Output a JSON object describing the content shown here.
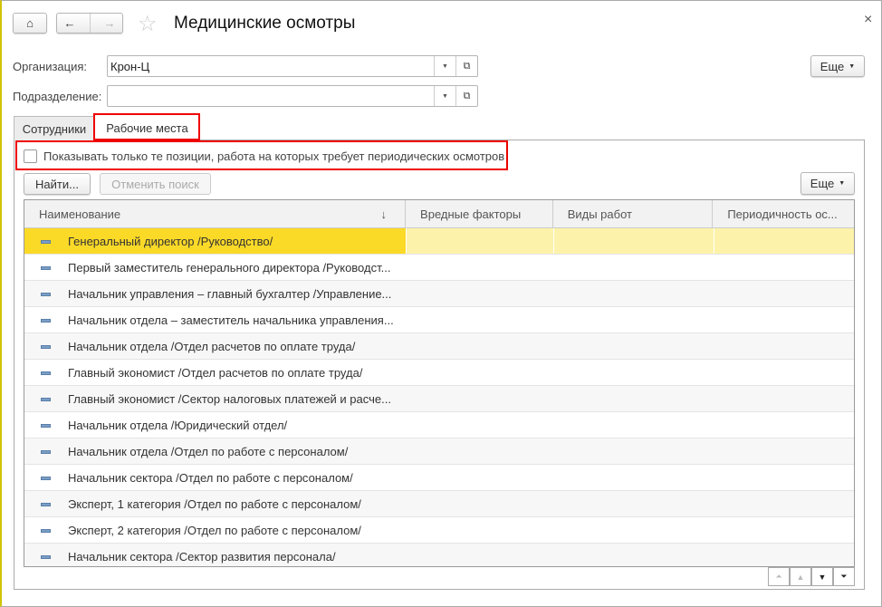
{
  "header": {
    "title": "Медицинские осмотры",
    "close": "×",
    "home_icon": "home-icon",
    "back_icon": "arrow-left-icon",
    "forward_icon": "arrow-right-icon",
    "favorite_icon": "star-icon"
  },
  "form": {
    "org_label": "Организация:",
    "org_value": "Крон-Ц",
    "dept_label": "Подразделение:",
    "dept_value": "",
    "more": "Еще"
  },
  "tabs": [
    {
      "label": "Сотрудники",
      "active": false
    },
    {
      "label": "Рабочие места",
      "active": true
    }
  ],
  "filter": {
    "checkbox_label": "Показывать только те позиции, работа на которых требует периодических осмотров",
    "checked": false
  },
  "toolbar": {
    "find": "Найти...",
    "cancel_search": "Отменить поиск",
    "more": "Еще"
  },
  "table": {
    "columns": [
      "Наименование",
      "Вредные факторы",
      "Виды работ",
      "Периодичность ос..."
    ],
    "sort_indicator": "↓",
    "rows": [
      "Генеральный директор /Руководство/",
      "Первый заместитель генерального директора /Руководст...",
      "Начальник управления – главный бухгалтер /Управление...",
      "Начальник отдела – заместитель начальника управления...",
      "Начальник отдела /Отдел расчетов по оплате труда/",
      "Главный экономист /Отдел расчетов по оплате труда/",
      "Главный экономист /Сектор налоговых платежей и расче...",
      "Начальник отдела /Юридический отдел/",
      "Начальник отдела /Отдел по работе с персоналом/",
      "Начальник сектора /Отдел по работе с персоналом/",
      "Эксперт, 1 категория /Отдел по работе с персоналом/",
      "Эксперт, 2 категория /Отдел по работе с персоналом/",
      "Начальник сектора /Сектор развития персонала/"
    ],
    "selected_row": 0
  },
  "colors": {
    "selected": "#fbd927",
    "selected_row": "#fdf2a9",
    "highlight": "#e00000"
  }
}
